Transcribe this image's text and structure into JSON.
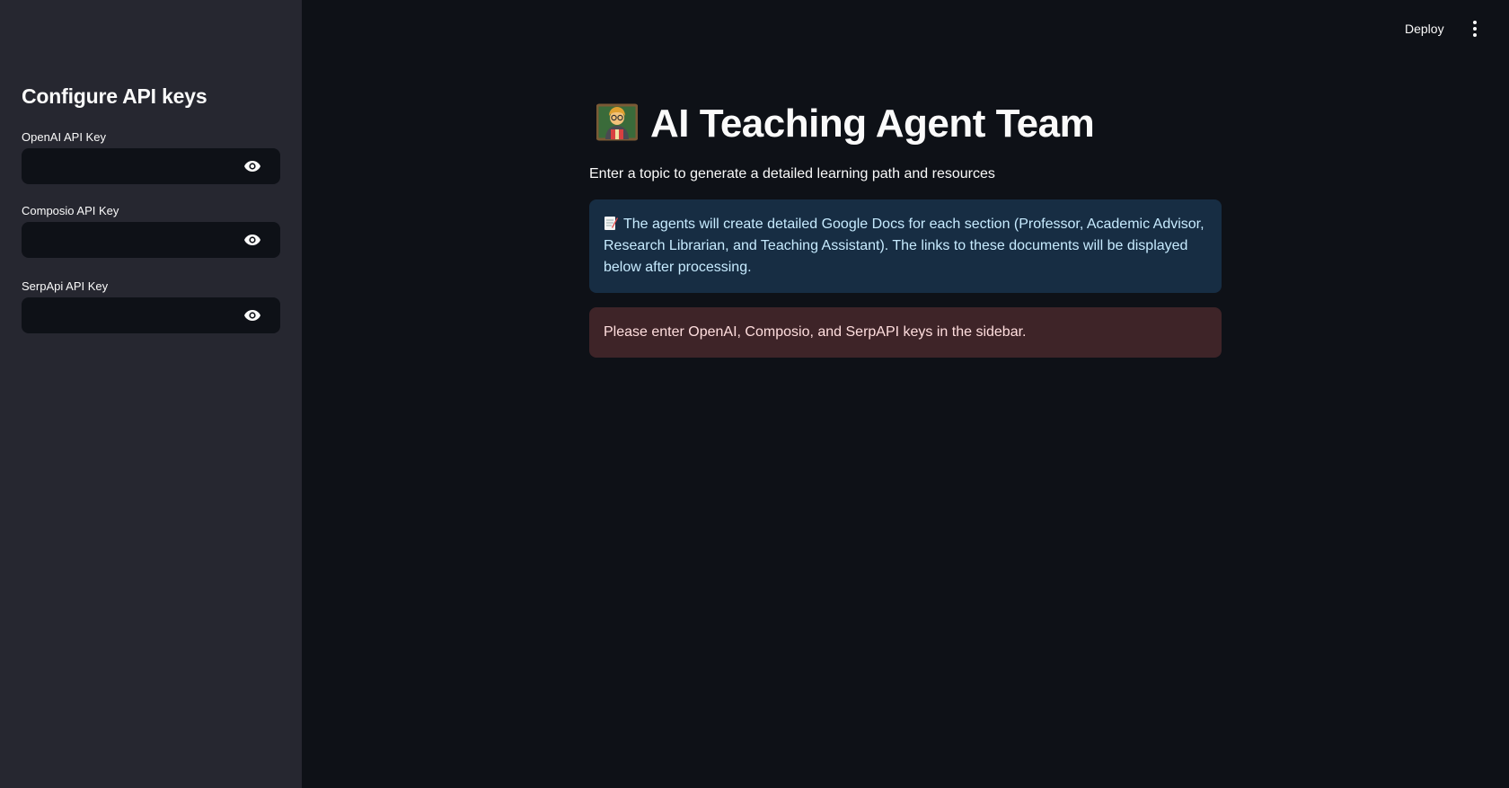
{
  "header": {
    "deploy_label": "Deploy",
    "menu_icon": "more-vertical-icon"
  },
  "sidebar": {
    "title": "Configure API keys",
    "fields": [
      {
        "label": "OpenAI API Key",
        "value": "",
        "icon": "eye-icon"
      },
      {
        "label": "Composio API Key",
        "value": "",
        "icon": "eye-icon"
      },
      {
        "label": "SerpApi API Key",
        "value": "",
        "icon": "eye-icon"
      }
    ]
  },
  "main": {
    "title_emoji": "teacher-emoji",
    "title": "AI Teaching Agent Team",
    "subtitle": "Enter a topic to generate a detailed learning path and resources",
    "info": {
      "icon": "memo-icon",
      "text": "The agents will create detailed Google Docs for each section (Professor, Academic Advisor, Research Librarian, and Teaching Assistant). The links to these documents will be displayed below after processing."
    },
    "error": {
      "text": "Please enter OpenAI, Composio, and SerpAPI keys in the sidebar."
    }
  },
  "colors": {
    "background": "#0e1117",
    "sidebar": "#262730",
    "info_bg": "#172d43",
    "info_text": "#c7ebff",
    "error_bg": "#3e2428",
    "error_text": "#ffdede"
  }
}
